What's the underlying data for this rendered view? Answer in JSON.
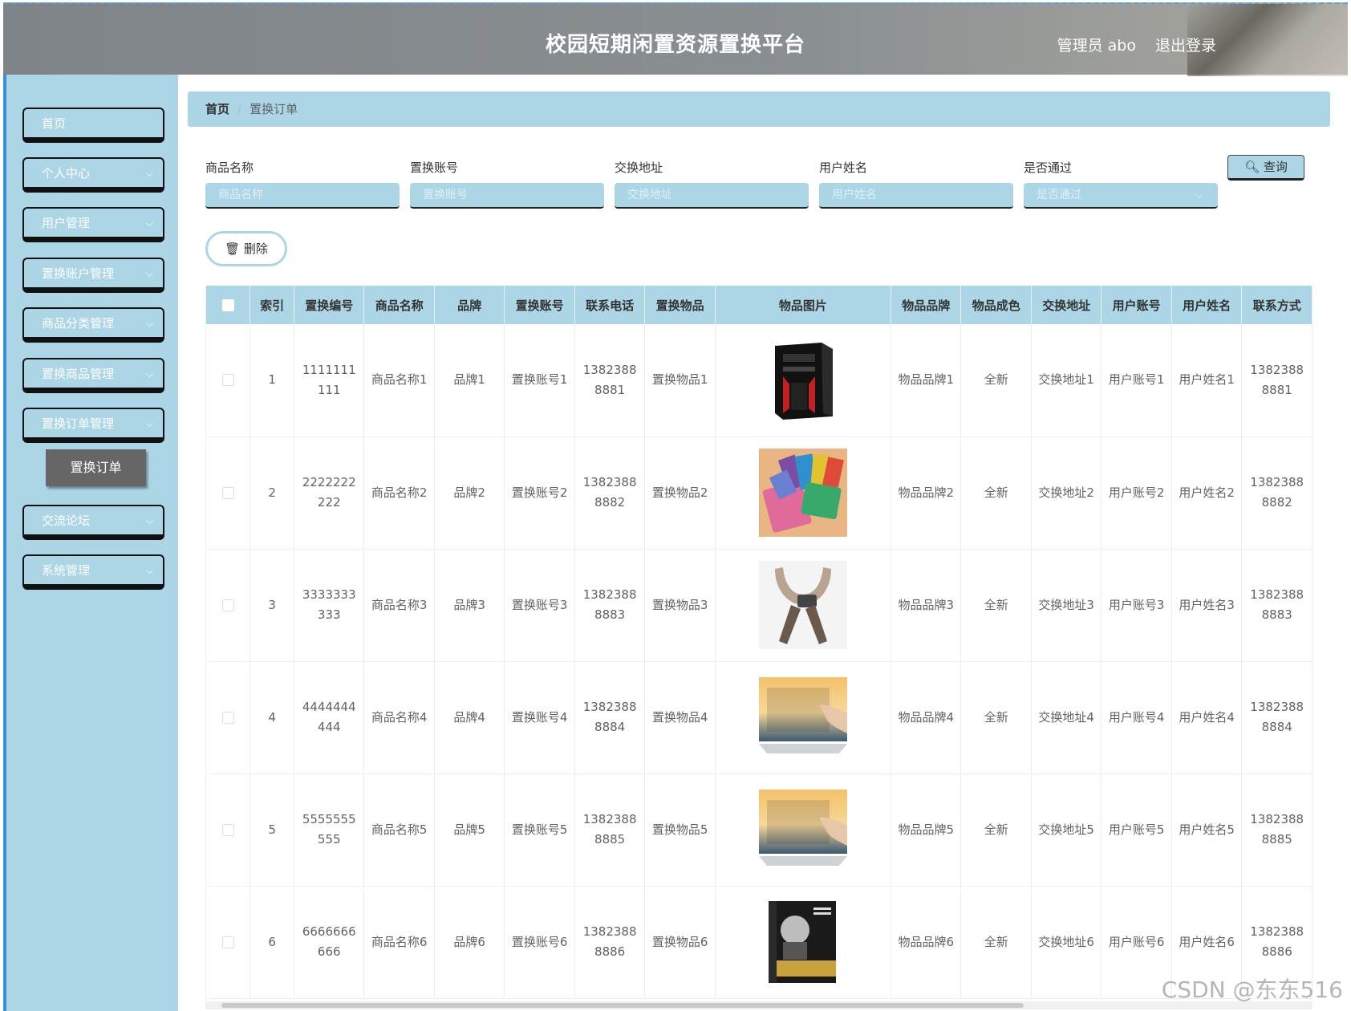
{
  "header": {
    "title": "校园短期闲置资源置换平台",
    "user_label": "管理员 abo",
    "logout_label": "退出登录"
  },
  "sidebar": {
    "items": [
      {
        "label": "首页",
        "has_arrow": false
      },
      {
        "label": "个人中心",
        "has_arrow": true
      },
      {
        "label": "用户管理",
        "has_arrow": true
      },
      {
        "label": "置换账户管理",
        "has_arrow": true
      },
      {
        "label": "商品分类管理",
        "has_arrow": true
      },
      {
        "label": "置换商品管理",
        "has_arrow": true
      },
      {
        "label": "置换订单管理",
        "has_arrow": true
      },
      {
        "label": "交流论坛",
        "has_arrow": true
      },
      {
        "label": "系统管理",
        "has_arrow": true
      }
    ],
    "active_subitem": "置换订单"
  },
  "breadcrumb": {
    "home": "首页",
    "current": "置换订单"
  },
  "filters": [
    {
      "label": "商品名称",
      "placeholder": "商品名称"
    },
    {
      "label": "置换账号",
      "placeholder": "置换账号"
    },
    {
      "label": "交换地址",
      "placeholder": "交换地址"
    },
    {
      "label": "用户姓名",
      "placeholder": "用户姓名"
    },
    {
      "label": "是否通过",
      "placeholder": "是否通过"
    }
  ],
  "buttons": {
    "search": "查询",
    "delete": "删除"
  },
  "table": {
    "columns": [
      "索引",
      "置换编号",
      "商品名称",
      "品牌",
      "置换账号",
      "联系电话",
      "置换物品",
      "物品图片",
      "物品品牌",
      "物品成色",
      "交换地址",
      "用户账号",
      "用户姓名",
      "联系方式"
    ],
    "rows": [
      {
        "index": "1",
        "code": "1111111111",
        "name": "商品名称1",
        "brand": "品牌1",
        "account": "置换账号1",
        "phone": "13823888881",
        "item": "置换物品1",
        "image": "pc-case",
        "item_brand": "物品品牌1",
        "condition": "全新",
        "address": "交换地址1",
        "user_account": "用户账号1",
        "user_name": "用户姓名1",
        "contact": "13823888881"
      },
      {
        "index": "2",
        "code": "2222222222",
        "name": "商品名称2",
        "brand": "品牌2",
        "account": "置换账号2",
        "phone": "13823888882",
        "item": "置换物品2",
        "image": "wallets",
        "item_brand": "物品品牌2",
        "condition": "全新",
        "address": "交换地址2",
        "user_account": "用户账号2",
        "user_name": "用户姓名2",
        "contact": "13823888882"
      },
      {
        "index": "3",
        "code": "3333333333",
        "name": "商品名称3",
        "brand": "品牌3",
        "account": "置换账号3",
        "phone": "13823888883",
        "item": "置换物品3",
        "image": "neck-massager",
        "item_brand": "物品品牌3",
        "condition": "全新",
        "address": "交换地址3",
        "user_account": "用户账号3",
        "user_name": "用户姓名3",
        "contact": "13823888883"
      },
      {
        "index": "4",
        "code": "4444444444",
        "name": "商品名称4",
        "brand": "品牌4",
        "account": "置换账号4",
        "phone": "13823888884",
        "item": "置换物品4",
        "image": "laptop",
        "item_brand": "物品品牌4",
        "condition": "全新",
        "address": "交换地址4",
        "user_account": "用户账号4",
        "user_name": "用户姓名4",
        "contact": "13823888884"
      },
      {
        "index": "5",
        "code": "5555555555",
        "name": "商品名称5",
        "brand": "品牌5",
        "account": "置换账号5",
        "phone": "13823888885",
        "item": "置换物品5",
        "image": "laptop",
        "item_brand": "物品品牌5",
        "condition": "全新",
        "address": "交换地址5",
        "user_account": "用户账号5",
        "user_name": "用户姓名5",
        "contact": "13823888885"
      },
      {
        "index": "6",
        "code": "6666666666",
        "name": "商品名称6",
        "brand": "品牌6",
        "account": "置换账号6",
        "phone": "13823888886",
        "item": "置换物品6",
        "image": "book",
        "item_brand": "物品品牌6",
        "condition": "全新",
        "address": "交换地址6",
        "user_account": "用户账号6",
        "user_name": "用户姓名6",
        "contact": "13823888886"
      }
    ]
  },
  "watermark": "CSDN @东东516",
  "colors": {
    "accent": "#acd6e6",
    "header": "#888c8f",
    "submenu_active": "#666666"
  }
}
